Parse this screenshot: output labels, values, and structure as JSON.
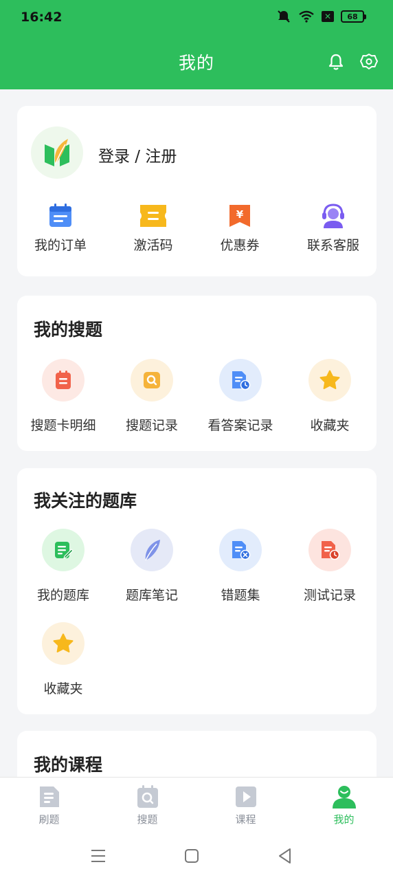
{
  "status": {
    "time": "16:42",
    "battery": "68",
    "x_box": "✕"
  },
  "header": {
    "title": "我的"
  },
  "profile": {
    "login_label": "登录 / 注册",
    "items": [
      {
        "label": "我的订单",
        "icon": "order-icon"
      },
      {
        "label": "激活码",
        "icon": "ticket-icon"
      },
      {
        "label": "优惠券",
        "icon": "coupon-icon"
      },
      {
        "label": "联系客服",
        "icon": "customer-service-icon"
      }
    ]
  },
  "my_search": {
    "title": "我的搜题",
    "items": [
      {
        "label": "搜题卡明细",
        "icon": "card-detail-icon"
      },
      {
        "label": "搜题记录",
        "icon": "search-record-icon"
      },
      {
        "label": "看答案记录",
        "icon": "answer-record-icon"
      },
      {
        "label": "收藏夹",
        "icon": "star-icon"
      }
    ]
  },
  "my_banks": {
    "title": "我关注的题库",
    "items": [
      {
        "label": "我的题库",
        "icon": "my-bank-icon"
      },
      {
        "label": "题库笔记",
        "icon": "feather-icon"
      },
      {
        "label": "错题集",
        "icon": "wrong-questions-icon"
      },
      {
        "label": "测试记录",
        "icon": "test-record-icon"
      },
      {
        "label": "收藏夹",
        "icon": "star-icon"
      }
    ]
  },
  "my_courses": {
    "title": "我的课程"
  },
  "tabbar": {
    "tabs": [
      {
        "label": "刷题",
        "icon": "practice-icon"
      },
      {
        "label": "搜题",
        "icon": "search-tab-icon"
      },
      {
        "label": "课程",
        "icon": "course-play-icon"
      },
      {
        "label": "我的",
        "icon": "profile-icon"
      }
    ],
    "active": 3
  },
  "colors": {
    "accent": "#2dbe5c",
    "background": "#f4f5f7"
  }
}
